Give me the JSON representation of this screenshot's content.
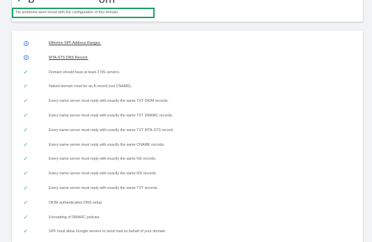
{
  "header": {
    "domain_start": "b",
    "domain_end": "om",
    "status_message": "No problems were found with the configuration of this domain."
  },
  "checks": [
    {
      "icon": "info-icon",
      "status": "info",
      "text": "Effective SPF Address Ranges.",
      "link": true
    },
    {
      "icon": "info-icon",
      "status": "info",
      "text": "MTA-STS DNS Record.",
      "link": true
    },
    {
      "icon": "check-icon",
      "status": "pass",
      "text": "Domain should have at least 2 NS servers.",
      "link": false
    },
    {
      "icon": "check-icon",
      "status": "pass",
      "text": "Naked domain must be an A record (not CNAME).",
      "link": false
    },
    {
      "icon": "check-icon",
      "status": "pass",
      "text": "Every name server must reply with exactly the same TXT DKIM records.",
      "link": false
    },
    {
      "icon": "check-icon",
      "status": "pass",
      "text": "Every name server must reply with exactly the same TXT DMARC records.",
      "link": false
    },
    {
      "icon": "check-icon",
      "status": "pass",
      "text": "Every name server must reply with exactly the same TXT MTA-STS record.",
      "link": false
    },
    {
      "icon": "check-icon",
      "status": "pass",
      "text": "Every name server must reply with exactly the same CNAME records.",
      "link": false
    },
    {
      "icon": "check-icon",
      "status": "pass",
      "text": "Every name server must reply with exactly the same NS records.",
      "link": false
    },
    {
      "icon": "check-icon",
      "status": "pass",
      "text": "Every name server must reply with exactly the same MX records.",
      "link": false
    },
    {
      "icon": "check-icon",
      "status": "pass",
      "text": "Every name server must reply with exactly the same TXT records.",
      "link": false
    },
    {
      "icon": "check-icon",
      "status": "pass",
      "text": "DKIM authentication DNS setup.",
      "link": false
    },
    {
      "icon": "check-icon",
      "status": "pass",
      "text": "Formatting of DMARC policies.",
      "link": false
    },
    {
      "icon": "check-icon",
      "status": "pass",
      "text": "SPF must allow Google servers to send mail on behalf of your domain.",
      "link": false
    }
  ],
  "colors": {
    "pass": "#34a853",
    "info": "#4285f4",
    "highlight_border": "#1aa260"
  }
}
